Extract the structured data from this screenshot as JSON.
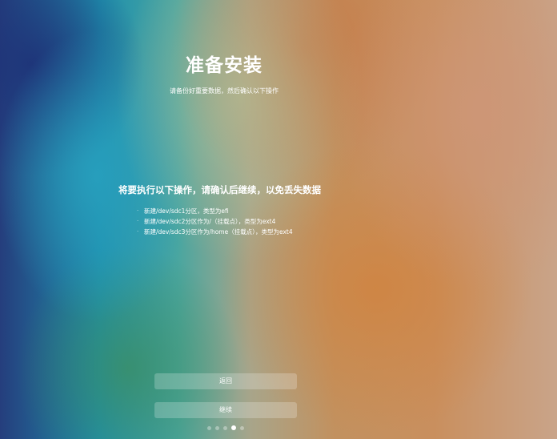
{
  "installer": {
    "title": "准备安装",
    "subtitle": "请备份好重要数据，然后确认以下操作",
    "operations_heading": "将要执行以下操作，请确认后继续，以免丢失数据",
    "operations": [
      "新建/dev/sdc1分区，类型为efi",
      "新建/dev/sdc2分区作为/（挂载点），类型为ext4",
      "新建/dev/sdc3分区作为/home（挂载点），类型为ext4"
    ],
    "bullet_char": "·",
    "back_label": "返回",
    "continue_label": "继续",
    "progress": {
      "total_steps": 5,
      "current_step": 4
    }
  }
}
